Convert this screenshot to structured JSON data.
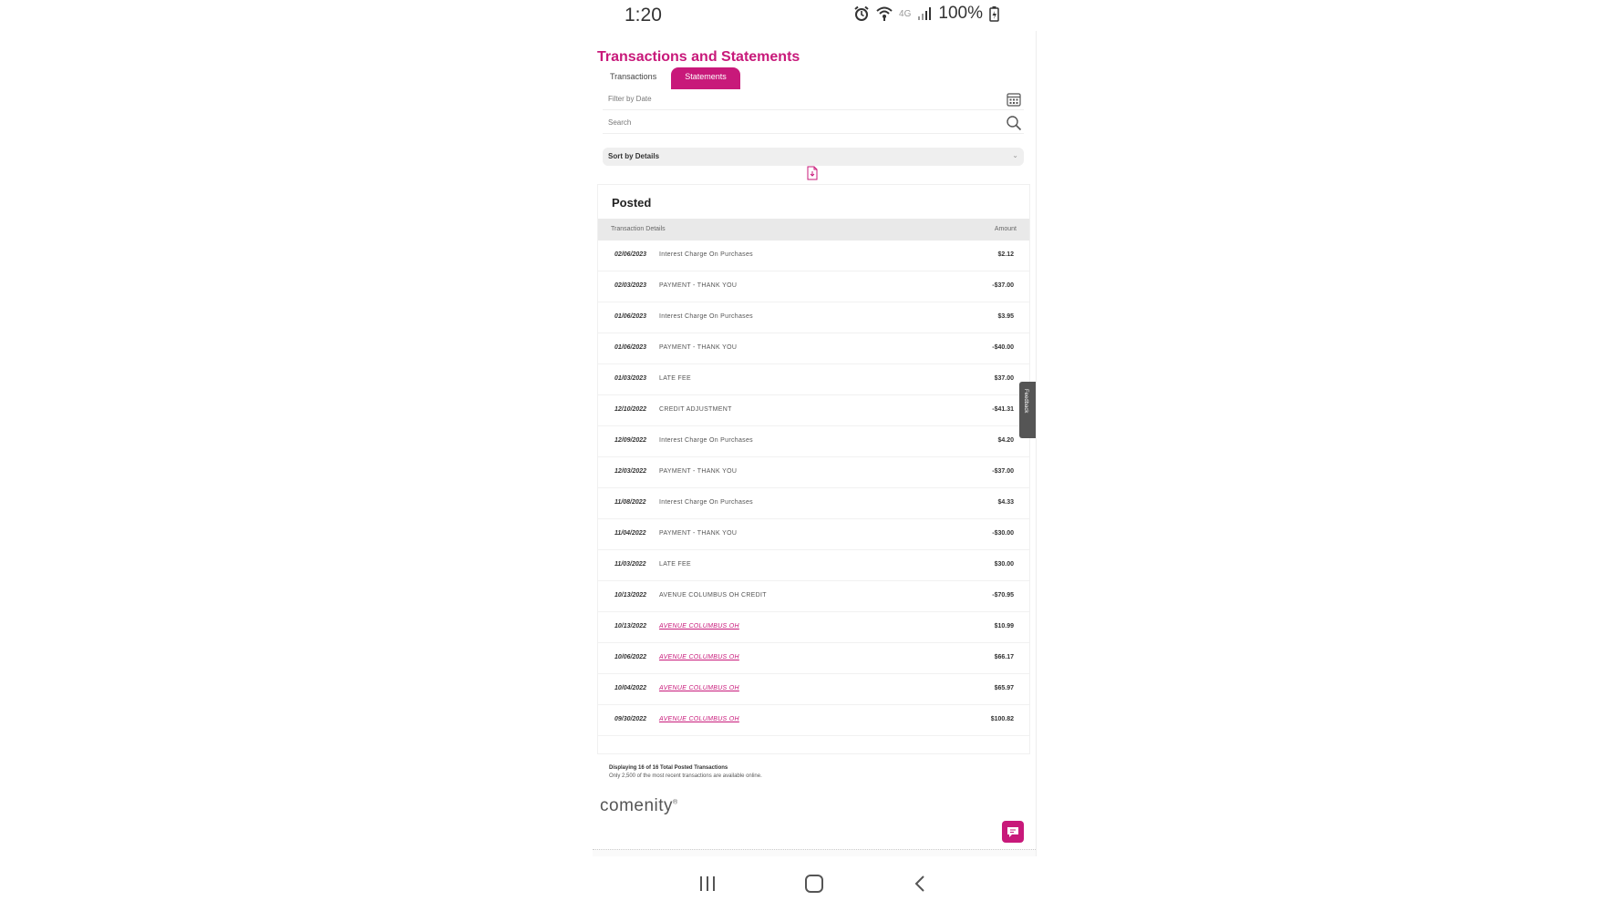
{
  "status_bar": {
    "time": "1:20",
    "network_label": "4G",
    "battery": "100%"
  },
  "page": {
    "title": "Transactions and Statements",
    "tabs": [
      {
        "label": "Transactions",
        "active": false
      },
      {
        "label": "Statements",
        "active": true
      }
    ]
  },
  "filters": {
    "date_placeholder": "Filter by Date",
    "search_placeholder": "Search",
    "sort_label": "Sort by Details",
    "sort_chevron": "⌄"
  },
  "posted": {
    "title": "Posted",
    "col_details": "Transaction Details",
    "col_amount": "Amount",
    "rows": [
      {
        "date": "02/06/2023",
        "desc": "Interest Charge On Purchases",
        "amount": "$2.12",
        "link": false
      },
      {
        "date": "02/03/2023",
        "desc": "PAYMENT - THANK YOU",
        "amount": "-$37.00",
        "link": false
      },
      {
        "date": "01/06/2023",
        "desc": "Interest Charge On Purchases",
        "amount": "$3.95",
        "link": false
      },
      {
        "date": "01/06/2023",
        "desc": "PAYMENT - THANK YOU",
        "amount": "-$40.00",
        "link": false
      },
      {
        "date": "01/03/2023",
        "desc": "LATE FEE",
        "amount": "$37.00",
        "link": false
      },
      {
        "date": "12/10/2022",
        "desc": "CREDIT ADJUSTMENT",
        "amount": "-$41.31",
        "link": false
      },
      {
        "date": "12/09/2022",
        "desc": "Interest Charge On Purchases",
        "amount": "$4.20",
        "link": false
      },
      {
        "date": "12/03/2022",
        "desc": "PAYMENT - THANK YOU",
        "amount": "-$37.00",
        "link": false
      },
      {
        "date": "11/08/2022",
        "desc": "Interest Charge On Purchases",
        "amount": "$4.33",
        "link": false
      },
      {
        "date": "11/04/2022",
        "desc": "PAYMENT - THANK YOU",
        "amount": "-$30.00",
        "link": false
      },
      {
        "date": "11/03/2022",
        "desc": "LATE FEE",
        "amount": "$30.00",
        "link": false
      },
      {
        "date": "10/13/2022",
        "desc": "AVENUE COLUMBUS OH CREDIT",
        "amount": "-$70.95",
        "link": false
      },
      {
        "date": "10/13/2022",
        "desc": "AVENUE COLUMBUS OH",
        "amount": "$10.99",
        "link": true
      },
      {
        "date": "10/06/2022",
        "desc": "AVENUE COLUMBUS OH",
        "amount": "$66.17",
        "link": true
      },
      {
        "date": "10/04/2022",
        "desc": "AVENUE COLUMBUS OH",
        "amount": "$65.97",
        "link": true
      },
      {
        "date": "09/30/2022",
        "desc": "AVENUE COLUMBUS OH",
        "amount": "$100.82",
        "link": true
      }
    ]
  },
  "footnote": {
    "count_text": "Displaying 16 of 16 Total Posted Transactions",
    "note_text": "Only 2,500 of the most recent transactions are available online."
  },
  "brand": {
    "logo_text": "comenity",
    "logo_mark": "®"
  },
  "feedback_label": "Feedback",
  "colors": {
    "accent": "#c8197a",
    "header_bg": "#e9e9e9"
  },
  "icons": [
    "alarm-icon",
    "wifi-icon",
    "signal-icon",
    "battery-icon",
    "calendar-icon",
    "search-icon",
    "pdf-download-icon",
    "chat-icon",
    "recents-icon",
    "home-icon",
    "back-icon"
  ]
}
